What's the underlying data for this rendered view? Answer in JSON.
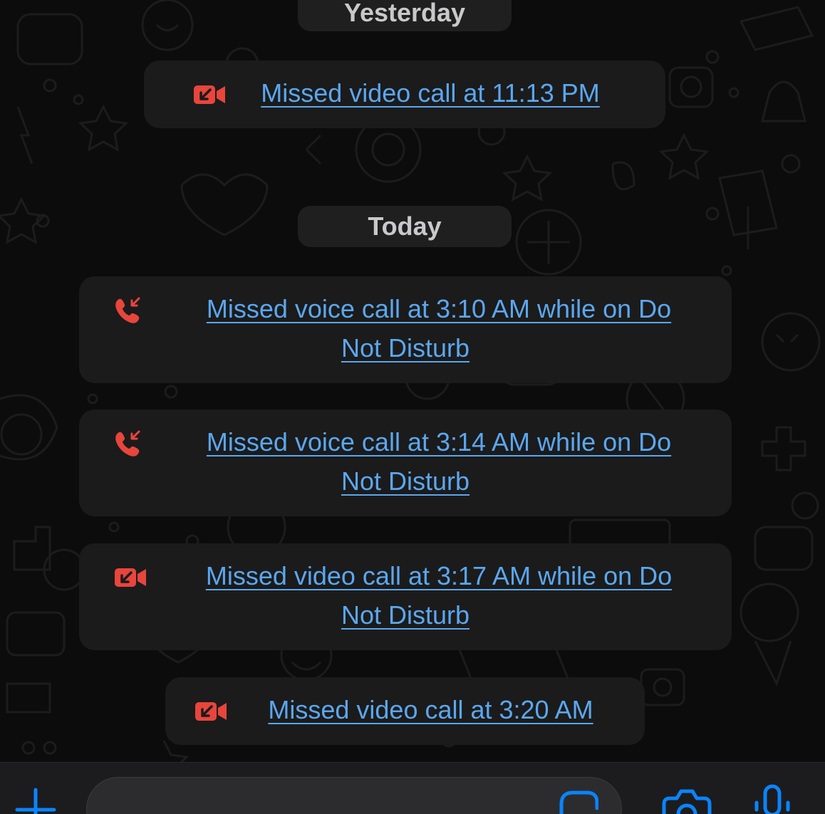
{
  "chat": {
    "date_yesterday": "Yesterday",
    "date_today": "Today",
    "calls": [
      {
        "type": "video",
        "line1": "Missed video call at 11:13 PM",
        "line2": ""
      },
      {
        "type": "voice",
        "line1": "Missed voice call at 3:10 AM while on Do",
        "line2": "Not Disturb"
      },
      {
        "type": "voice",
        "line1": "Missed voice call at 3:14 AM while on Do",
        "line2": "Not Disturb"
      },
      {
        "type": "video",
        "line1": "Missed video call at 3:17 AM while on Do",
        "line2": "Not Disturb"
      },
      {
        "type": "video",
        "line1": "Missed video call at 3:20 AM",
        "line2": ""
      }
    ]
  },
  "composer": {
    "placeholder": "",
    "icons": [
      "plus-icon",
      "sticker-icon",
      "camera-icon",
      "microphone-icon"
    ]
  },
  "colors": {
    "background": "#0c0c0c",
    "bubble": "#1b1b1b",
    "link": "#5ba7f0",
    "missed_call_red": "#e8453c",
    "accent_blue": "#0a84ff"
  }
}
